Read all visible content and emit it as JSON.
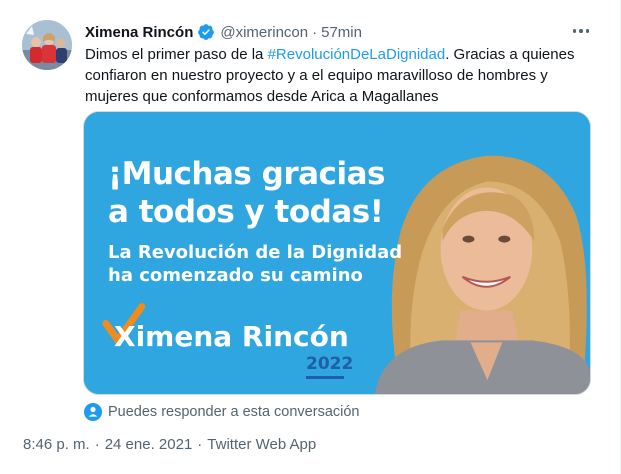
{
  "tweet": {
    "author": {
      "display_name": "Ximena Rincón",
      "handle": "@ximerincon",
      "verified": true,
      "avatar_icon": "avatar-photo"
    },
    "relative_time": "57min",
    "separator": "·",
    "text_before": "Dimos el primer paso de la ",
    "hashtag": "#RevoluciónDeLaDignidad",
    "text_after": ". Gracias a quienes confiaron en nuestro proyecto y a el equipo maravilloso de hombres y mujeres que conformamos desde Arica a Magallanes",
    "media": {
      "headline_line1": "¡Muchas gracias",
      "headline_line2": "a todos y todas!",
      "subline_line1": "La Revolución de la Dignidad",
      "subline_line2": "ha comenzado su camino",
      "brand_name": "Ximena Rincón",
      "brand_year": "2022",
      "background_color": "#2fa6df",
      "check_color": "#f28b1e"
    },
    "reply_restriction": "Puedes responder a esta conversación",
    "timestamp": "8:46 p. m.",
    "date": "24 ene. 2021",
    "source": "Twitter Web App"
  },
  "colors": {
    "accent": "#1d9bf0",
    "secondary_text": "#536471",
    "primary_text": "#0f1419"
  }
}
